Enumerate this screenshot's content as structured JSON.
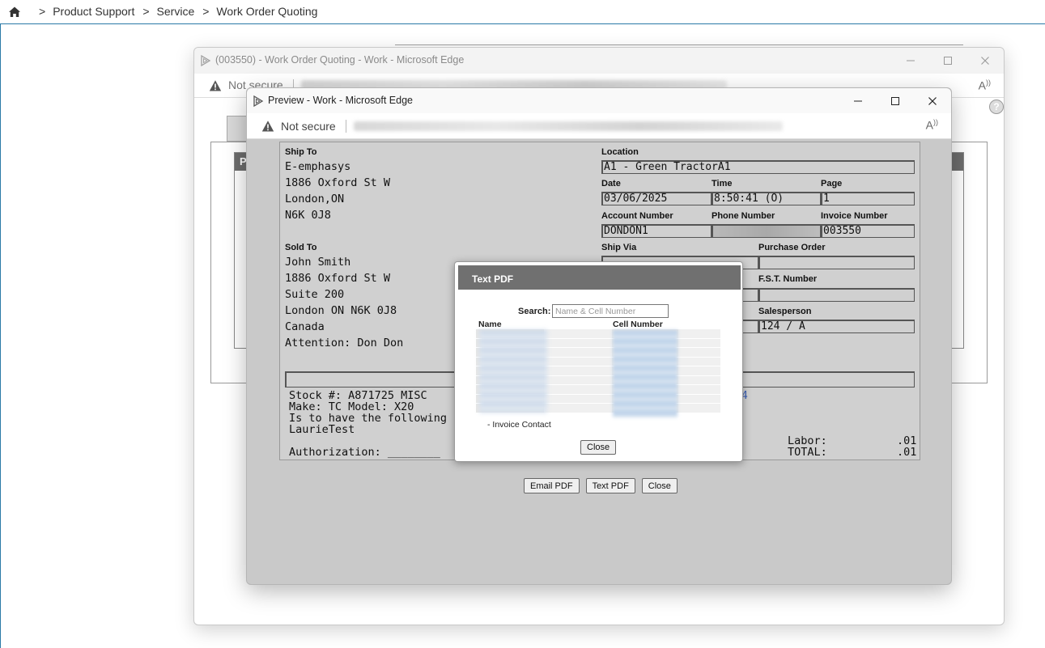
{
  "breadcrumb": {
    "items": [
      {
        "sep": ">",
        "label": "Product Support"
      },
      {
        "sep": ">",
        "label": "Service"
      },
      {
        "sep": ">",
        "label": "Work Order Quoting"
      }
    ]
  },
  "outer_window": {
    "title": "(003550) - Work Order Quoting - Work - Microsoft Edge",
    "security": "Not secure",
    "bg_header_letter": "P"
  },
  "preview_window": {
    "title": "Preview - Work - Microsoft Edge",
    "security": "Not secure"
  },
  "document": {
    "ship_to": {
      "label": "Ship To",
      "lines": [
        "E-emphasys",
        "1886 Oxford St W",
        "London,ON",
        "N6K 0J8"
      ]
    },
    "sold_to": {
      "label": "Sold To",
      "lines": [
        "John Smith",
        "1886 Oxford St W",
        "Suite 200",
        "London ON N6K 0J8",
        "Canada",
        "Attention: Don Don"
      ]
    },
    "location": {
      "label": "Location",
      "value": "A1 - Green TractorA1"
    },
    "date": {
      "label": "Date",
      "value": "03/06/2025"
    },
    "time": {
      "label": "Time",
      "value": "8:50:41 (O)"
    },
    "page": {
      "label": "Page",
      "value": "1"
    },
    "account_number": {
      "label": "Account Number",
      "value": "DONDON1"
    },
    "phone_number": {
      "label": "Phone Number",
      "value": ""
    },
    "invoice_number": {
      "label": "Invoice Number",
      "value": "003550"
    },
    "ship_via": {
      "label": "Ship Via",
      "value": ""
    },
    "purchase_order": {
      "label": "Purchase Order",
      "value": ""
    },
    "fst_number": {
      "label": "F.S.T. Number",
      "value": ""
    },
    "salesperson": {
      "label": "Salesperson",
      "value": "124 / A"
    },
    "body_lines": [
      "Stock #: A871725    MISC",
      "Make: TC  Model: X20",
      "Is to have the following",
      "LaurieTest"
    ],
    "authorization": "Authorization: ________",
    "link_fragment": "4",
    "labor": {
      "label": "Labor:",
      "value": ".01"
    },
    "total": {
      "label": "TOTAL:",
      "value": ".01"
    }
  },
  "doc_buttons": {
    "email_pdf": "Email PDF",
    "text_pdf": "Text PDF",
    "close": "Close"
  },
  "dialog": {
    "title": "Text PDF",
    "search_label": "Search:",
    "search_placeholder": "Name & Cell Number",
    "search_value": "",
    "columns": {
      "name": "Name",
      "cell": "Cell Number"
    },
    "legend": "-  Invoice Contact",
    "close_label": "Close"
  },
  "icons": {
    "home": "home-icon",
    "warning": "warning-icon",
    "read_aloud": "read-aloud-icon",
    "help": "help-icon",
    "app": "edge-app-icon"
  },
  "colors": {
    "accent": "#2b7aa7",
    "dialog_header": "#707070",
    "doc_bg": "#d0d0d0"
  }
}
